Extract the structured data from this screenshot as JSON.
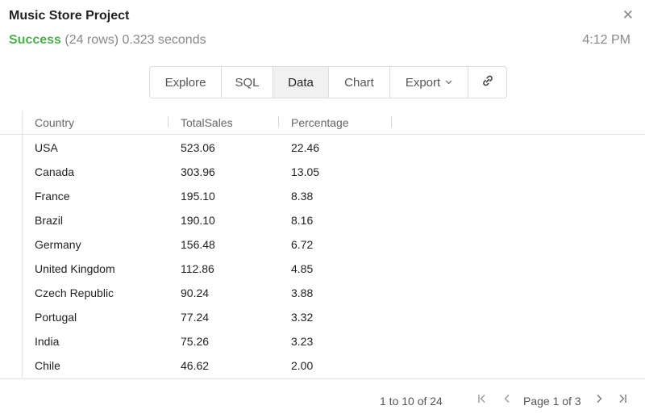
{
  "header": {
    "title": "Music Store Project",
    "status": "Success",
    "rows_info": "(24 rows) 0.323 seconds",
    "time": "4:12 PM",
    "close_glyph": "✕"
  },
  "tabs": [
    {
      "label": "Explore"
    },
    {
      "label": "SQL"
    },
    {
      "label": "Data",
      "active": true
    },
    {
      "label": "Chart"
    },
    {
      "label": "Export"
    }
  ],
  "table": {
    "columns": [
      "Country",
      "TotalSales",
      "Percentage"
    ],
    "rows": [
      [
        "USA",
        "523.06",
        "22.46"
      ],
      [
        "Canada",
        "303.96",
        "13.05"
      ],
      [
        "France",
        "195.10",
        "8.38"
      ],
      [
        "Brazil",
        "190.10",
        "8.16"
      ],
      [
        "Germany",
        "156.48",
        "6.72"
      ],
      [
        "United Kingdom",
        "112.86",
        "4.85"
      ],
      [
        "Czech Republic",
        "90.24",
        "3.88"
      ],
      [
        "Portugal",
        "77.24",
        "3.32"
      ],
      [
        "India",
        "75.26",
        "3.23"
      ],
      [
        "Chile",
        "46.62",
        "2.00"
      ]
    ]
  },
  "pagination": {
    "range": "1 to 10 of 24",
    "page": "Page 1 of 3"
  },
  "colors": {
    "success": "#4caf50",
    "muted": "#888888"
  }
}
